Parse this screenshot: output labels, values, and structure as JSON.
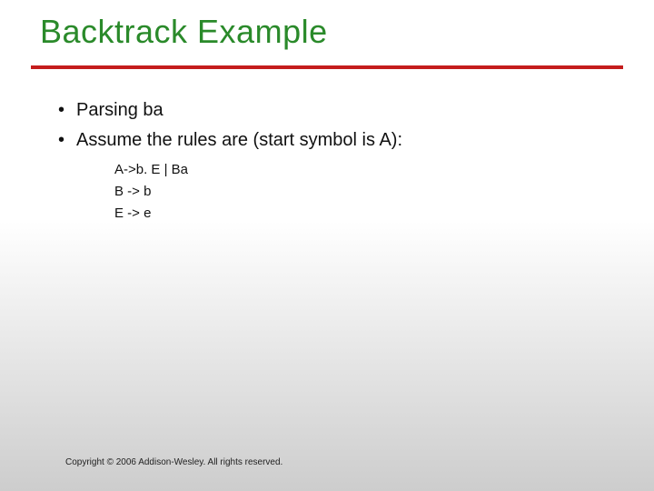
{
  "title": "Backtrack Example",
  "bullets": {
    "b1": "Parsing ba",
    "b2": "Assume the rules are (start symbol is A):"
  },
  "rules": {
    "r1": "A->b. E  | Ba",
    "r2": "B -> b",
    "r3": "E -> e"
  },
  "copyright": "Copyright © 2006 Addison-Wesley. All rights reserved."
}
